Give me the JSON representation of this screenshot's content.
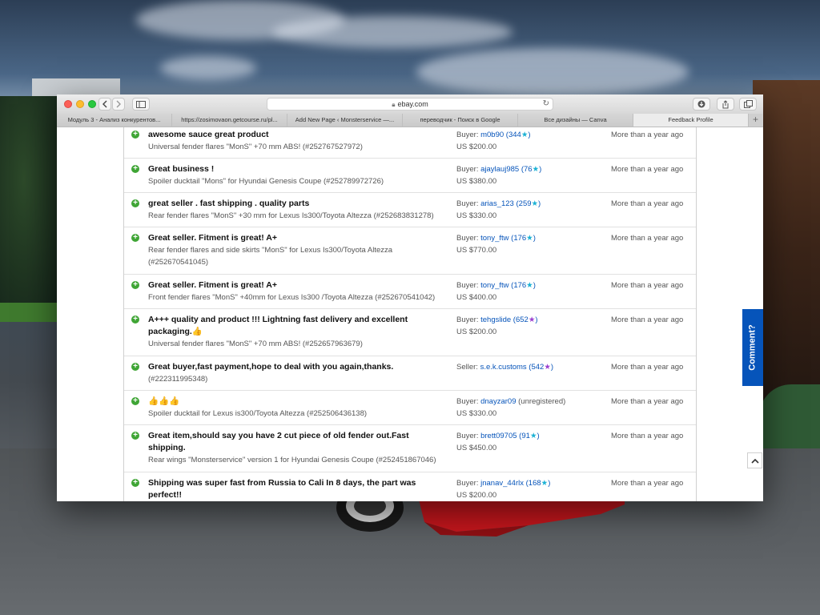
{
  "browser": {
    "url": "ebay.com",
    "tabs": [
      {
        "label": "Модуль 3 - Анализ конкурентов..."
      },
      {
        "label": "https://zosimovaon.getcourse.ru/pl..."
      },
      {
        "label": "Add New Page ‹ Monsterservice —..."
      },
      {
        "label": "переводчик - Поиск в Google"
      },
      {
        "label": "Все дизайны — Canva"
      },
      {
        "label": "Feedback Profile"
      }
    ],
    "new_tab": "+"
  },
  "feedback": {
    "rows": [
      {
        "comment": "awesome sauce great product",
        "item": "Universal fender flares \"MonS\" +70 mm ABS! (#252767527972)",
        "role": "Buyer:",
        "user": "m0b90",
        "score_open": " (",
        "score": "344",
        "star": "★",
        "score_close": ")",
        "price": "US $200.00",
        "when": "More than a year ago"
      },
      {
        "comment": "Great business !",
        "item": "Spoiler ducktail \"Mons\" for Hyundai Genesis Coupe (#252789972726)",
        "role": "Buyer:",
        "user": "ajaylauj985",
        "score_open": " (",
        "score": "76",
        "star": "★",
        "score_close": ")",
        "price": "US $380.00",
        "when": "More than a year ago"
      },
      {
        "comment": "great seller . fast shipping . quality parts",
        "item": "Rear fender flares \"MonS\" +30 mm for Lexus Is300/Toyota Altezza (#252683831278)",
        "role": "Buyer:",
        "user": "arias_123",
        "score_open": " (",
        "score": "259",
        "star": "★",
        "score_close": ")",
        "price": "US $330.00",
        "when": "More than a year ago"
      },
      {
        "comment": "Great seller. Fitment is great! A+",
        "item": "Rear fender flares and side skirts \"MonS\" for Lexus Is300/Toyota Altezza (#252670541045)",
        "role": "Buyer:",
        "user": "tony_ftw",
        "score_open": " (",
        "score": "176",
        "star": "★",
        "score_close": ")",
        "price": "US $770.00",
        "when": "More than a year ago"
      },
      {
        "comment": "Great seller. Fitment is great! A+",
        "item": "Front fender flares \"MonS\" +40mm for Lexus Is300 /Toyota Altezza (#252670541042)",
        "role": "Buyer:",
        "user": "tony_ftw",
        "score_open": " (",
        "score": "176",
        "star": "★",
        "score_close": ")",
        "price": "US $400.00",
        "when": "More than a year ago"
      },
      {
        "comment": "A+++ quality and product !!! Lightning fast delivery and excellent packaging.👍",
        "item": "Universal fender flares \"MonS\" +70 mm ABS! (#252657963679)",
        "role": "Buyer:",
        "user": "tehgslide",
        "score_open": " (",
        "score": "652",
        "star": "★",
        "score_close": ")",
        "price": "US $200.00",
        "when": "More than a year ago"
      },
      {
        "comment": "Great buyer,fast payment,hope to deal with you again,thanks.",
        "item": "(#222311995348)",
        "role": "Seller:",
        "user": "s.e.k.customs",
        "score_open": " (",
        "score": "542",
        "star": "★",
        "score_close": ")",
        "price": "",
        "when": "More than a year ago"
      },
      {
        "comment": "👍👍👍",
        "item": "Spoiler ducktail for Lexus is300/Toyota Altezza (#252506436138)",
        "role": "Buyer:",
        "user": "dnayzar09",
        "score_open": " (",
        "score": "unregistered",
        "star": "",
        "score_close": ")",
        "price": "US $330.00",
        "when": "More than a year ago"
      },
      {
        "comment": "Great item,should say you have 2 cut piece of old fender out.Fast shipping.",
        "item": "Rear wings \"Monsterservice\" version 1 for Hyundai Genesis Coupe (#252451867046)",
        "role": "Buyer:",
        "user": "brett09705",
        "score_open": " (",
        "score": "91",
        "star": "★",
        "score_close": ")",
        "price": "US $450.00",
        "when": "More than a year ago"
      },
      {
        "comment": "Shipping was super fast from Russia to Cali In 8 days, the part was perfect!!",
        "item": "",
        "role": "Buyer:",
        "user": "jnanav_44rlx",
        "score_open": " (",
        "score": "168",
        "star": "★",
        "score_close": ")",
        "price": "US $200.00",
        "when": "More than a year ago"
      }
    ]
  },
  "comment_tab": {
    "label": "Comment?"
  },
  "colors": {
    "accent": "#0654ba",
    "positive": "#3fa535",
    "star_teal": "#1ab1d4",
    "star_purple": "#9b3fd0"
  }
}
